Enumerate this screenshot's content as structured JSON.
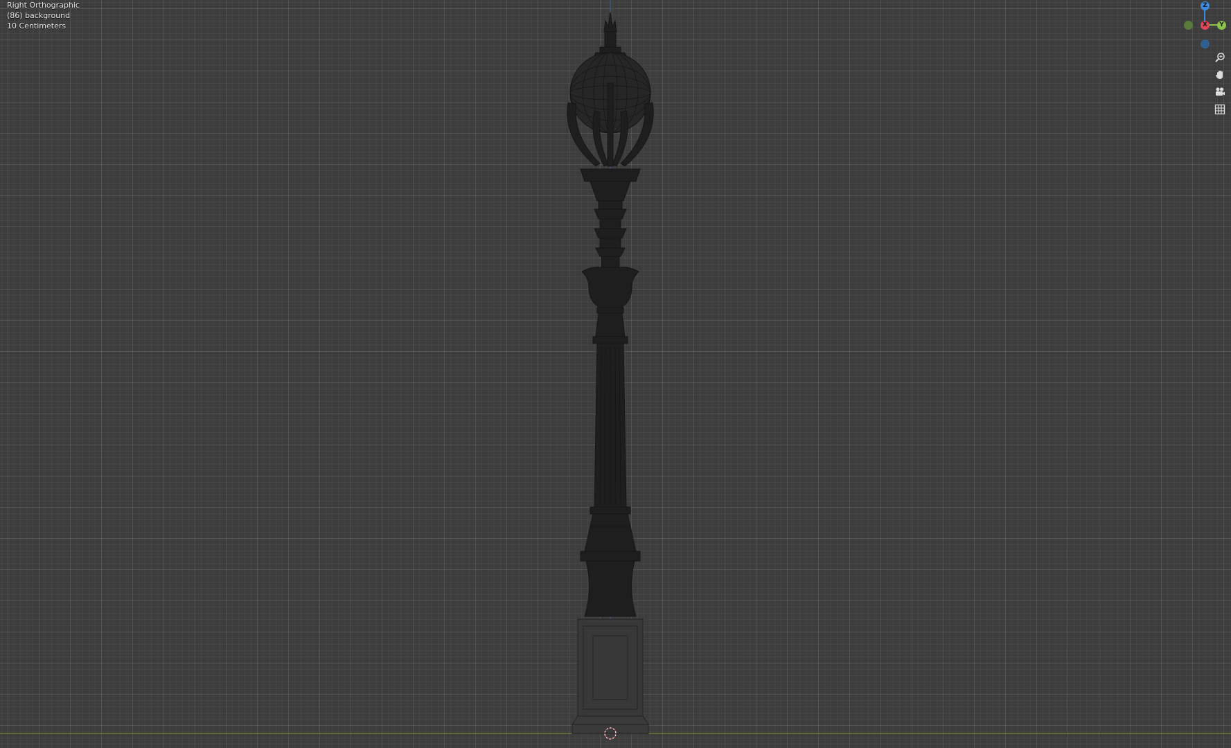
{
  "viewport": {
    "view_name": "Right Orthographic",
    "object_info": "(86) background",
    "scale_info": "10 Centimeters"
  },
  "gizmo": {
    "axis_z": "Z",
    "axis_x": "X",
    "axis_y": "Y",
    "colors": {
      "x": "#e0475b",
      "y": "#8bc34a",
      "z": "#3d8be0",
      "y_negative": "#5a7a3a",
      "z_negative": "#2f5f8f"
    }
  },
  "nav_tools": {
    "icons": [
      "zoom-icon",
      "pan-hand-icon",
      "camera-icon",
      "grid-icon"
    ]
  },
  "colors": {
    "background": "#3d3d3d",
    "ground_line": "#8a8f3a",
    "z_axis_line": "#3d6fb0",
    "wireframe": "#1a1a1a",
    "cursor": "#e05050"
  }
}
